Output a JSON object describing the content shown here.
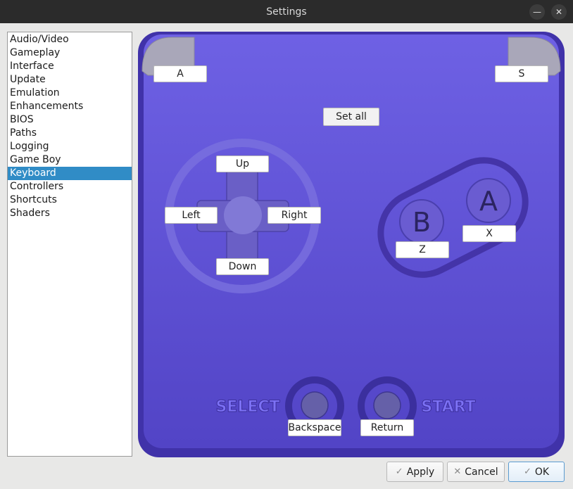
{
  "window": {
    "title": "Settings",
    "minimize_glyph": "—",
    "close_glyph": "✕"
  },
  "sidebar": {
    "items": [
      {
        "label": "Audio/Video"
      },
      {
        "label": "Gameplay"
      },
      {
        "label": "Interface"
      },
      {
        "label": "Update"
      },
      {
        "label": "Emulation"
      },
      {
        "label": "Enhancements"
      },
      {
        "label": "BIOS"
      },
      {
        "label": "Paths"
      },
      {
        "label": "Logging"
      },
      {
        "label": "Game Boy"
      },
      {
        "label": "Keyboard"
      },
      {
        "label": "Controllers"
      },
      {
        "label": "Shortcuts"
      },
      {
        "label": "Shaders"
      }
    ],
    "selected": "Keyboard"
  },
  "gamepad": {
    "face_letter_b": "B",
    "face_letter_a": "A",
    "select_text": "SELECT",
    "start_text": "START",
    "colors": {
      "body": "#5c4fd4",
      "body_light": "#6d60e6",
      "rim": "#3f33a8",
      "ring": "#7a6fe0",
      "dpad": "#6a5fc4",
      "face_button": "#6657cf",
      "select_start_text": "#7b70f2"
    }
  },
  "bindings": {
    "l": "A",
    "r": "S",
    "set_all": "Set all",
    "up": "Up",
    "down": "Down",
    "left": "Left",
    "right": "Right",
    "a": "X",
    "b": "Z",
    "select": "Backspace",
    "start": "Return"
  },
  "buttons": {
    "apply": "Apply",
    "cancel": "Cancel",
    "ok": "OK",
    "check_icon": "✓",
    "x_icon": "✕"
  }
}
